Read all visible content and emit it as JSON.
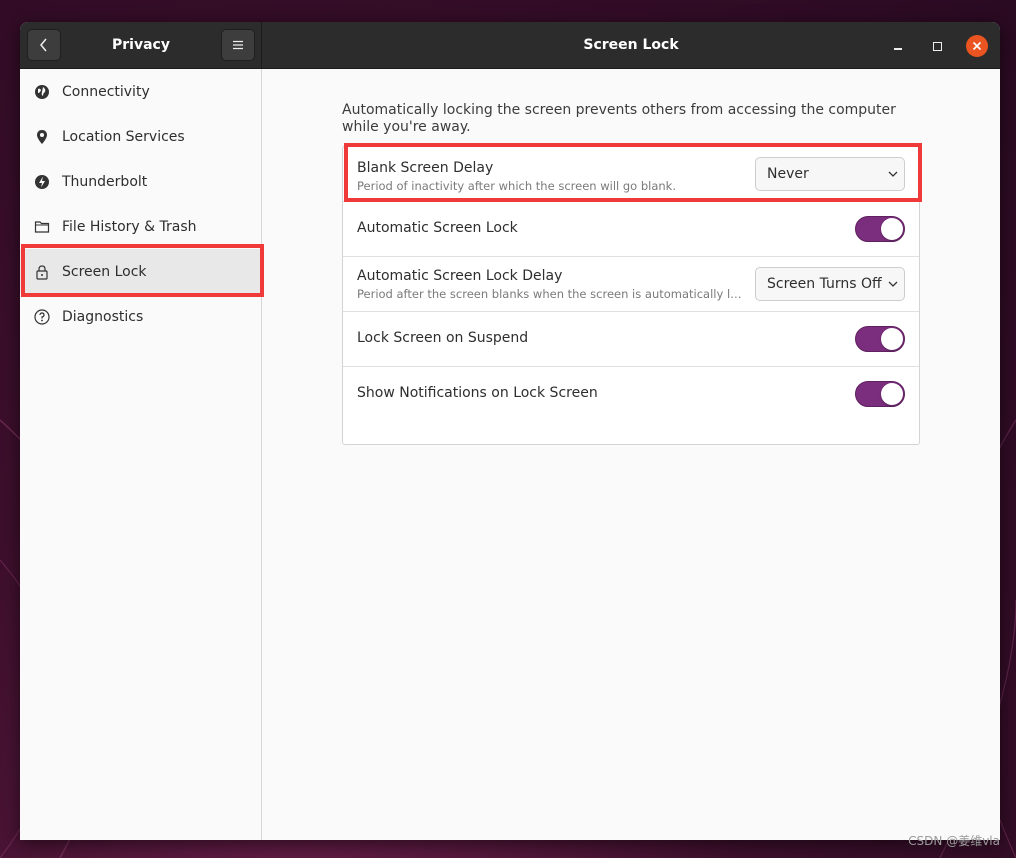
{
  "window": {
    "sidebar_title": "Privacy",
    "main_title": "Screen Lock"
  },
  "sidebar": {
    "items": [
      {
        "label": "Connectivity",
        "icon": "globe-icon"
      },
      {
        "label": "Location Services",
        "icon": "location-pin-icon"
      },
      {
        "label": "Thunderbolt",
        "icon": "thunderbolt-icon"
      },
      {
        "label": "File History & Trash",
        "icon": "folder-icon"
      },
      {
        "label": "Screen Lock",
        "icon": "lock-icon",
        "selected": true
      },
      {
        "label": "Diagnostics",
        "icon": "question-icon"
      }
    ]
  },
  "main": {
    "description": "Automatically locking the screen prevents others from accessing the computer while you're away.",
    "rows": [
      {
        "title": "Blank Screen Delay",
        "subtitle": "Period of inactivity after which the screen will go blank.",
        "control": "dropdown",
        "value": "Never"
      },
      {
        "title": "Automatic Screen Lock",
        "control": "toggle",
        "on": true
      },
      {
        "title": "Automatic Screen Lock Delay",
        "subtitle": "Period after the screen blanks when the screen is automatically locked.",
        "control": "dropdown",
        "value": "Screen Turns Off"
      },
      {
        "title": "Lock Screen on Suspend",
        "control": "toggle",
        "on": true
      },
      {
        "title": "Show Notifications on Lock Screen",
        "control": "toggle",
        "on": true
      }
    ]
  },
  "colors": {
    "accent_toggle": "#7b2e7d",
    "close_button": "#e95420",
    "highlight": "#f03a3a"
  },
  "watermark": "CSDN @姜维vla"
}
